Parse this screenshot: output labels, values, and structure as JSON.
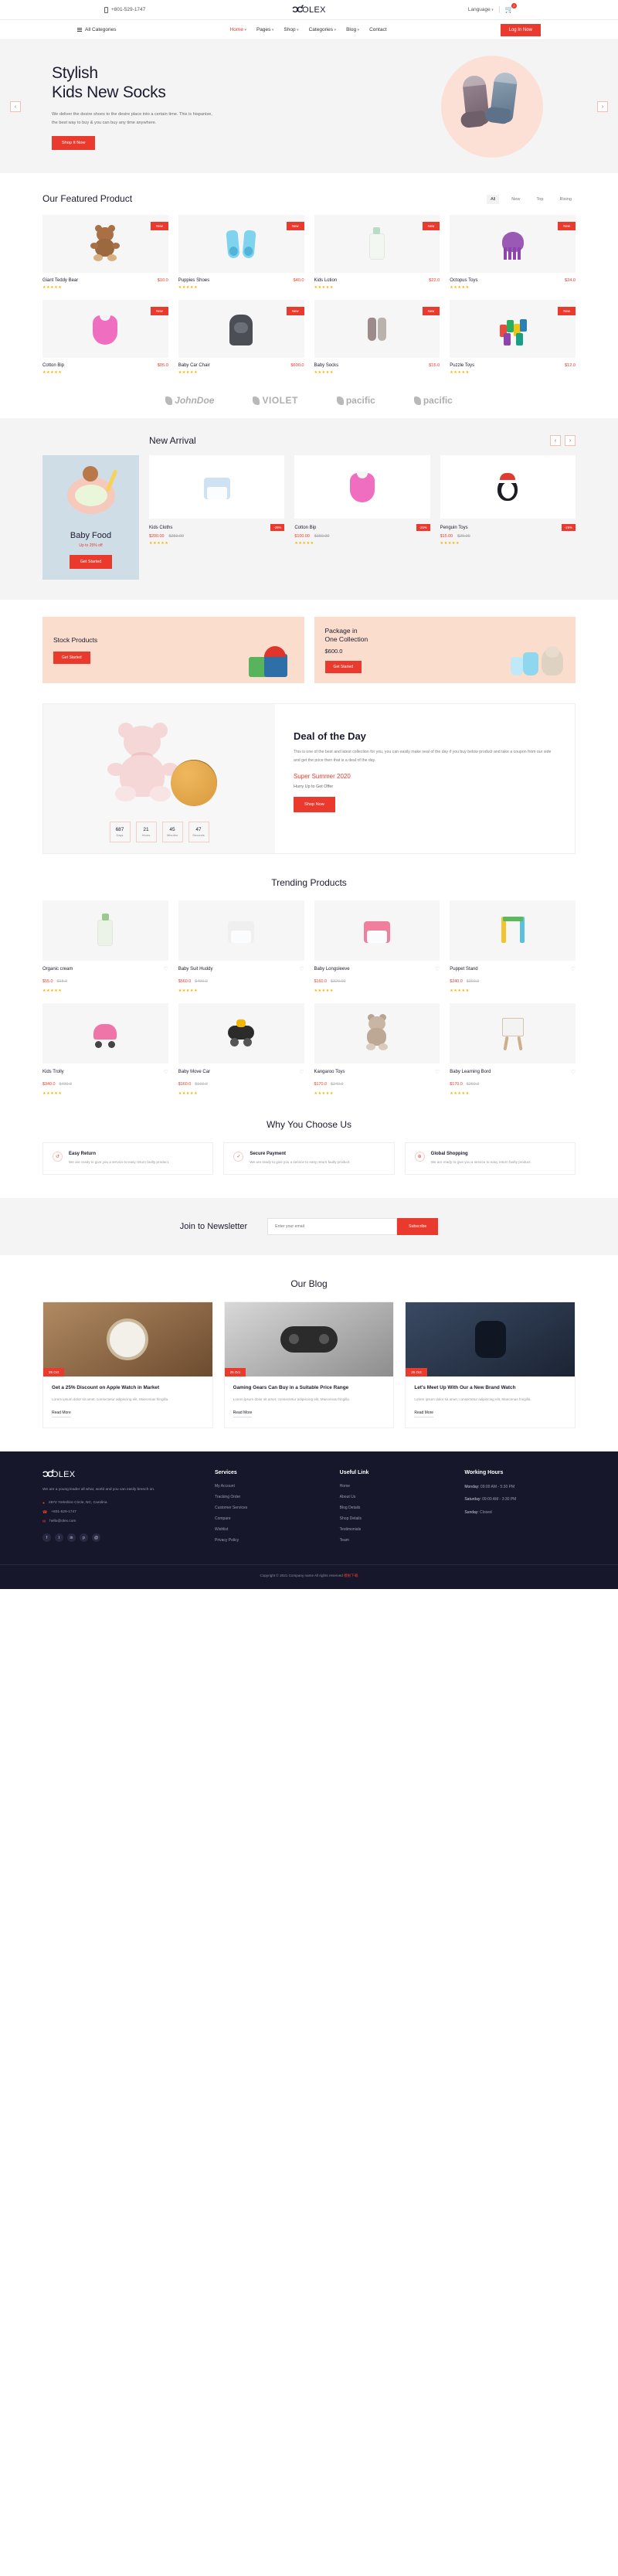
{
  "topbar": {
    "phone": "+801-529-1747",
    "logo_text": "OLEX",
    "language": "Language",
    "cart_count": "2"
  },
  "nav": {
    "all_categories": "All Categories",
    "items": [
      {
        "label": "Home",
        "caret": true,
        "active": true
      },
      {
        "label": "Pages",
        "caret": true,
        "active": false
      },
      {
        "label": "Shop",
        "caret": true,
        "active": false
      },
      {
        "label": "Categories",
        "caret": true,
        "active": false
      },
      {
        "label": "Blog",
        "caret": true,
        "active": false
      },
      {
        "label": "Contact",
        "caret": false,
        "active": false
      }
    ],
    "login_label": "Log In Now"
  },
  "hero": {
    "title_line1": "Stylish",
    "title_line2": "Kids New Socks",
    "description": "We deliver the desire shoes to the desire place into a certain time. This is hispanise, the best way to buy & you can buy any time anywhere.",
    "button": "Shop It Now",
    "prev": "‹",
    "next": "›"
  },
  "featured": {
    "title": "Our Featured Product",
    "filters": [
      {
        "label": "All",
        "active": true
      },
      {
        "label": "New",
        "active": false
      },
      {
        "label": "Top",
        "active": false
      },
      {
        "label": "Rising",
        "active": false
      }
    ],
    "badge_label": "New",
    "products": [
      {
        "name": "Giant Teddy Bear",
        "price": "$10.0",
        "art": "bear",
        "badge": true
      },
      {
        "name": "Puppies Shoes",
        "price": "$40.0",
        "art": "shoes",
        "badge": true
      },
      {
        "name": "Kids Lotion",
        "price": "$22.0",
        "art": "lotion",
        "badge": true
      },
      {
        "name": "Octopus Toys",
        "price": "$24.0",
        "art": "octopus",
        "badge": true
      },
      {
        "name": "Cotton Bip",
        "price": "$05.0",
        "art": "bip",
        "badge": true
      },
      {
        "name": "Baby Car Chair",
        "price": "$600.0",
        "art": "chair",
        "badge": true
      },
      {
        "name": "Baby Socks",
        "price": "$15.0",
        "art": "socks",
        "badge": true
      },
      {
        "name": "Puzzle Toys",
        "price": "$12.0",
        "art": "puzzle",
        "badge": true
      }
    ]
  },
  "brands": [
    {
      "name": "JohnDoe"
    },
    {
      "name": "VIOLET"
    },
    {
      "name": "pacific"
    },
    {
      "name": "pacific"
    }
  ],
  "new_arrival": {
    "title": "New Arrival",
    "prev": "‹",
    "next": "›",
    "promo": {
      "title": "Baby Food",
      "offer": "Up to 25% off",
      "button": "Get Started"
    },
    "products": [
      {
        "name": "Kids Cloths",
        "badge": "-25%",
        "price": "$200.00",
        "old_price": "$250.00",
        "art": "cloths"
      },
      {
        "name": "Cotton Bip",
        "badge": "-25%",
        "price": "$100.00",
        "old_price": "$150.00",
        "art": "bip"
      },
      {
        "name": "Penguin Toys",
        "badge": "-25%",
        "price": "$15.00",
        "old_price": "$20.00",
        "art": "penguin"
      }
    ]
  },
  "promos": [
    {
      "title_line1": "Stock Products",
      "title_line2": "",
      "price": "",
      "button": "Get Started",
      "art": "gifts"
    },
    {
      "title_line1": "Package in",
      "title_line2": "One Collection",
      "price": "$600.0",
      "button": "Get Started",
      "art": "bundle"
    }
  ],
  "deal": {
    "title": "Deal of the Day",
    "description": "This is one of the best and latest collection for you, you can easily make seal of the day if you buy below product and take a coupon from our side and get the price then that is a deal of the day.",
    "subtitle": "Super Summer 2020",
    "hurry": "Hurry Up to Get Offer",
    "button": "Shop Now",
    "counter": [
      {
        "value": "687",
        "label": "Days"
      },
      {
        "value": "21",
        "label": "Hours"
      },
      {
        "value": "45",
        "label": "Minutes"
      },
      {
        "value": "47",
        "label": "Seconds"
      }
    ]
  },
  "trending": {
    "title": "Trending Products",
    "products": [
      {
        "name": "Organic cream",
        "price": "$55.0",
        "old_price": "$18.0",
        "art": "cream"
      },
      {
        "name": "Baby Suit Huddy",
        "price": "$560.0",
        "old_price": "$400.0",
        "art": "suit"
      },
      {
        "name": "Baby Longsleeve",
        "price": "$160.0",
        "old_price": "$320.00",
        "art": "longsleeve"
      },
      {
        "name": "Puppet Stand",
        "price": "$240.0",
        "old_price": "$360.0",
        "art": "puppet"
      },
      {
        "name": "Kids Trolly",
        "price": "$340.0",
        "old_price": "$400.0",
        "art": "trolly"
      },
      {
        "name": "Baby Move Car",
        "price": "$160.0",
        "old_price": "$160.0",
        "art": "movecar"
      },
      {
        "name": "Kangaroo Toys",
        "price": "$170.0",
        "old_price": "$240.0",
        "art": "kangaroo"
      },
      {
        "name": "Baby Learning Bord",
        "price": "$170.0",
        "old_price": "$260.0",
        "art": "board"
      }
    ]
  },
  "why": {
    "title": "Why You Choose Us",
    "cards": [
      {
        "icon": "↺",
        "icon_name": "return-icon",
        "title": "Easy Return",
        "text": "We are ready to give you a service to easy return faulty product."
      },
      {
        "icon": "✓",
        "icon_name": "shield-icon",
        "title": "Secure Payment",
        "text": "We are ready to give you a service to easy return faulty product."
      },
      {
        "icon": "⊕",
        "icon_name": "globe-icon",
        "title": "Global Shopping",
        "text": "We are ready to give you a service to easy return faulty product."
      }
    ]
  },
  "newsletter": {
    "title": "Join to Newsletter",
    "placeholder": "Enter your email",
    "button": "Subscribe"
  },
  "blog": {
    "title": "Our Blog",
    "posts": [
      {
        "tag": "25 Oct",
        "title": "Get a 25% Discount on Apple Watch in Market",
        "text": "Lorem ipsum dolor sit amet, consectetur adipiscing elit, Maecenas fringilla.",
        "more": "Read More",
        "art": "watch"
      },
      {
        "tag": "25 Oct",
        "title": "Gaming Gears Can Buy in a Suitable Price Range",
        "text": "Lorem ipsum dolor sit amet, consectetur adipiscing elit, Maecenas fringilla.",
        "more": "Read More",
        "art": "gamepad"
      },
      {
        "tag": "25 Oct",
        "title": "Let's Meet Up With Our a New Brand Watch",
        "text": "Lorem ipsum dolor sit amet, consectetur adipiscing elit, Maecenas fringilla.",
        "more": "Read More",
        "art": "smartwatch"
      }
    ]
  },
  "footer": {
    "logo_text": "OLEX",
    "about": "We are a young leader all what, world and you can easily brench on.",
    "address": "2672 Yorkshire Circle, NC, Carolina",
    "phone": "+801-529-1747",
    "email": "hello@olex.com",
    "socials": [
      "f",
      "t",
      "in",
      "p",
      "@"
    ],
    "services": {
      "title": "Services",
      "items": [
        "My Account",
        "Tracking Order",
        "Customer Services",
        "Compare",
        "Wishlist",
        "Privacy Policy"
      ]
    },
    "useful": {
      "title": "Useful Link",
      "items": [
        "Home",
        "About Us",
        "Blog Details",
        "Shop Details",
        "Testimonials",
        "Team"
      ]
    },
    "hours": {
      "title": "Working Hours",
      "lines": [
        {
          "label": "Monday:",
          "value": "09:00 AM - 5:30 PM"
        },
        {
          "label": "Saturday:",
          "value": "09:00 AM - 3:30 PM"
        },
        {
          "label": "Sunday:",
          "value": "Closed"
        }
      ]
    },
    "copyright_pre": "Copyright © 2021 Company name All rights reserved ",
    "copyright_link": "模板下载"
  }
}
